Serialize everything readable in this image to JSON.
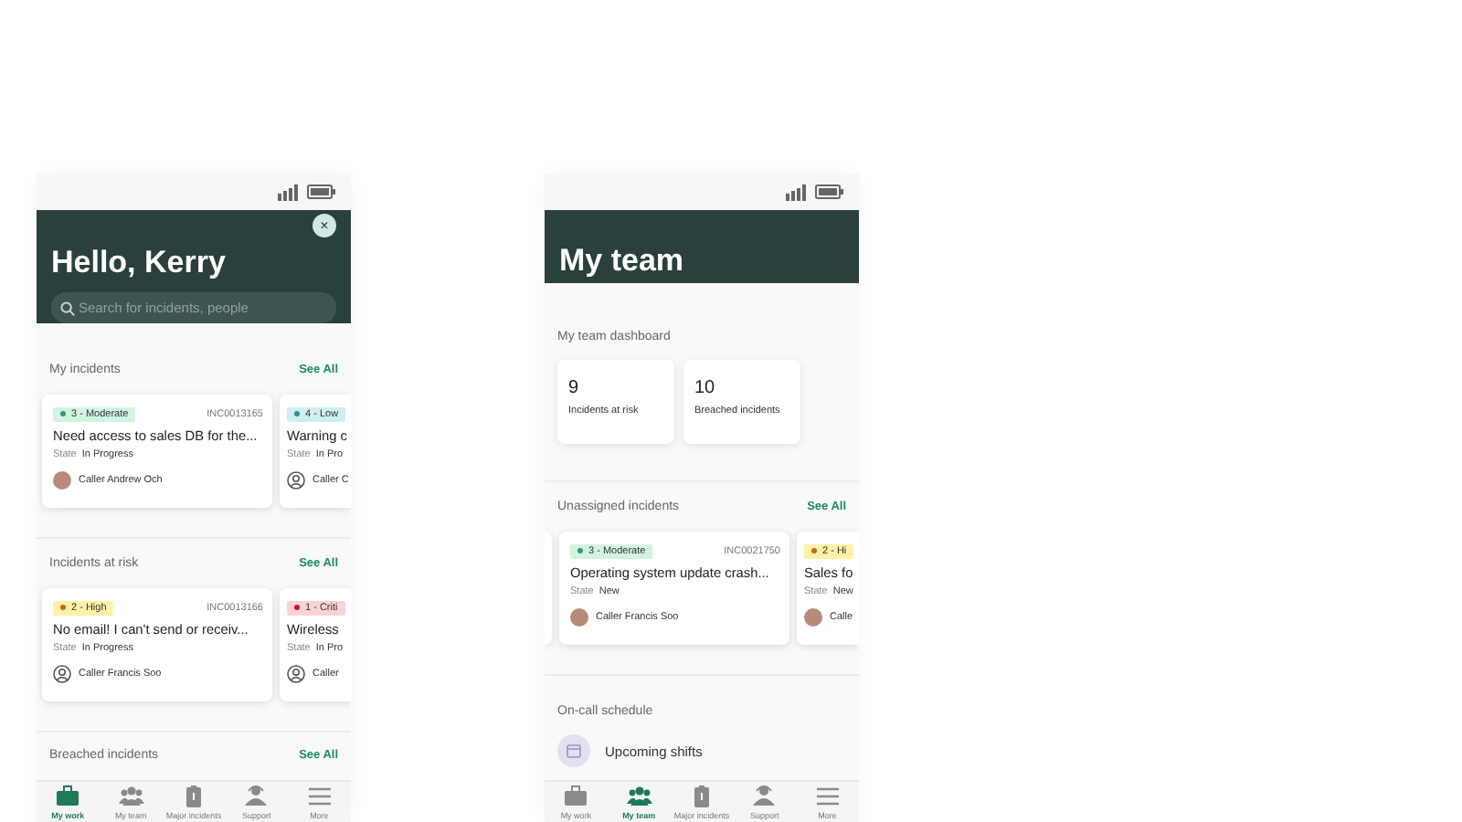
{
  "phones": [
    {
      "header": {
        "title": "Hello, Kerry",
        "close_label": "×",
        "search_placeholder": "Search for incidents, people"
      },
      "sections": [
        {
          "kind": "incidents",
          "title": "My incidents",
          "see_all": "See All",
          "cards": [
            {
              "priority": "3 - Moderate",
              "color": "#2e9e6a",
              "number": "INC0013165",
              "title": "Need access to sales DB for the...",
              "state_label": "State",
              "state": "In Progress",
              "caller": "Caller Andrew Och",
              "avatar": {
                "kind": "photo"
              },
              "partial": false
            },
            {
              "priority": "4 - Low",
              "color": "#2a8f9a",
              "title": "Warning c",
              "state_label": "State",
              "state": "In Pro",
              "caller": "Caller C",
              "avatar": {
                "kind": "person"
              },
              "partial": true
            }
          ]
        },
        {
          "kind": "incidents",
          "title": "Incidents at risk",
          "see_all": "See All",
          "cards": [
            {
              "priority": "2 - High",
              "color": "#c0691a",
              "number": "INC0013166",
              "title": "No email! I can't send or receiv...",
              "state_label": "State",
              "state": "In Progress",
              "caller": "Caller Francis Soo",
              "avatar": {
                "kind": "person"
              },
              "partial": false
            },
            {
              "priority": "1 - Criti",
              "color": "#c8102e",
              "title": "Wireless",
              "state_label": "State",
              "state": "In Pro",
              "caller": "Caller",
              "avatar": {
                "kind": "person"
              },
              "partial": true
            }
          ]
        },
        {
          "kind": "heading",
          "title": "Breached incidents",
          "see_all": "See All"
        }
      ],
      "nav": [
        {
          "label": "My work",
          "selected": true
        },
        {
          "label": "My team",
          "selected": false
        },
        {
          "label": "Major incidents",
          "selected": false
        },
        {
          "label": "Support",
          "selected": false
        },
        {
          "label": "More",
          "selected": false
        }
      ]
    },
    {
      "header": {
        "title": "My team"
      },
      "sections": [
        {
          "kind": "dashboard",
          "title": "My team dashboard",
          "tiles": [
            {
              "value": "9",
              "label": "Incidents at risk"
            },
            {
              "value": "10",
              "label": "Breached incidents"
            }
          ]
        },
        {
          "kind": "incidents",
          "title": "Unassigned incidents",
          "see_all": "See All",
          "leading_peek": true,
          "cards": [
            {
              "priority": "3 - Moderate",
              "color": "#2e9e6a",
              "number": "INC0021750",
              "title": "Operating system update crash...",
              "state_label": "State",
              "state": "New",
              "caller": "Caller Francis Soo",
              "avatar": {
                "kind": "photo"
              },
              "partial": false
            },
            {
              "priority": "2 - Hi",
              "color": "#c0691a",
              "title": "Sales fo",
              "state_label": "State",
              "state": "New",
              "caller": "Calle",
              "avatar": {
                "kind": "photo"
              },
              "partial": true
            }
          ]
        },
        {
          "kind": "schedule",
          "title": "On-call schedule",
          "items": [
            "Upcoming shifts"
          ]
        }
      ],
      "nav": [
        {
          "label": "My work",
          "selected": false
        },
        {
          "label": "My team",
          "selected": true
        },
        {
          "label": "Major incidents",
          "selected": false
        },
        {
          "label": "Support",
          "selected": false
        },
        {
          "label": "More",
          "selected": false
        }
      ]
    }
  ]
}
